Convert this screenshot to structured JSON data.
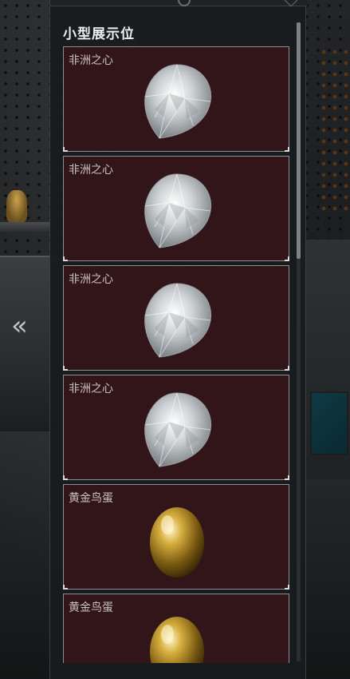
{
  "panel": {
    "title": "小型展示位",
    "items": [
      {
        "label": "非洲之心",
        "icon": "diamond-gem-icon"
      },
      {
        "label": "非洲之心",
        "icon": "diamond-gem-icon"
      },
      {
        "label": "非洲之心",
        "icon": "diamond-gem-icon"
      },
      {
        "label": "非洲之心",
        "icon": "diamond-gem-icon"
      },
      {
        "label": "黄金鸟蛋",
        "icon": "golden-egg-icon"
      },
      {
        "label": "黄金鸟蛋",
        "icon": "golden-egg-icon"
      }
    ]
  },
  "nav": {
    "back_label": "«",
    "icon": "double-chevron-left-icon"
  },
  "colors": {
    "card_bg": "#321518",
    "panel_bg": "#181c1e",
    "title_text": "#eceff1",
    "label_text": "#c9c2c2"
  }
}
